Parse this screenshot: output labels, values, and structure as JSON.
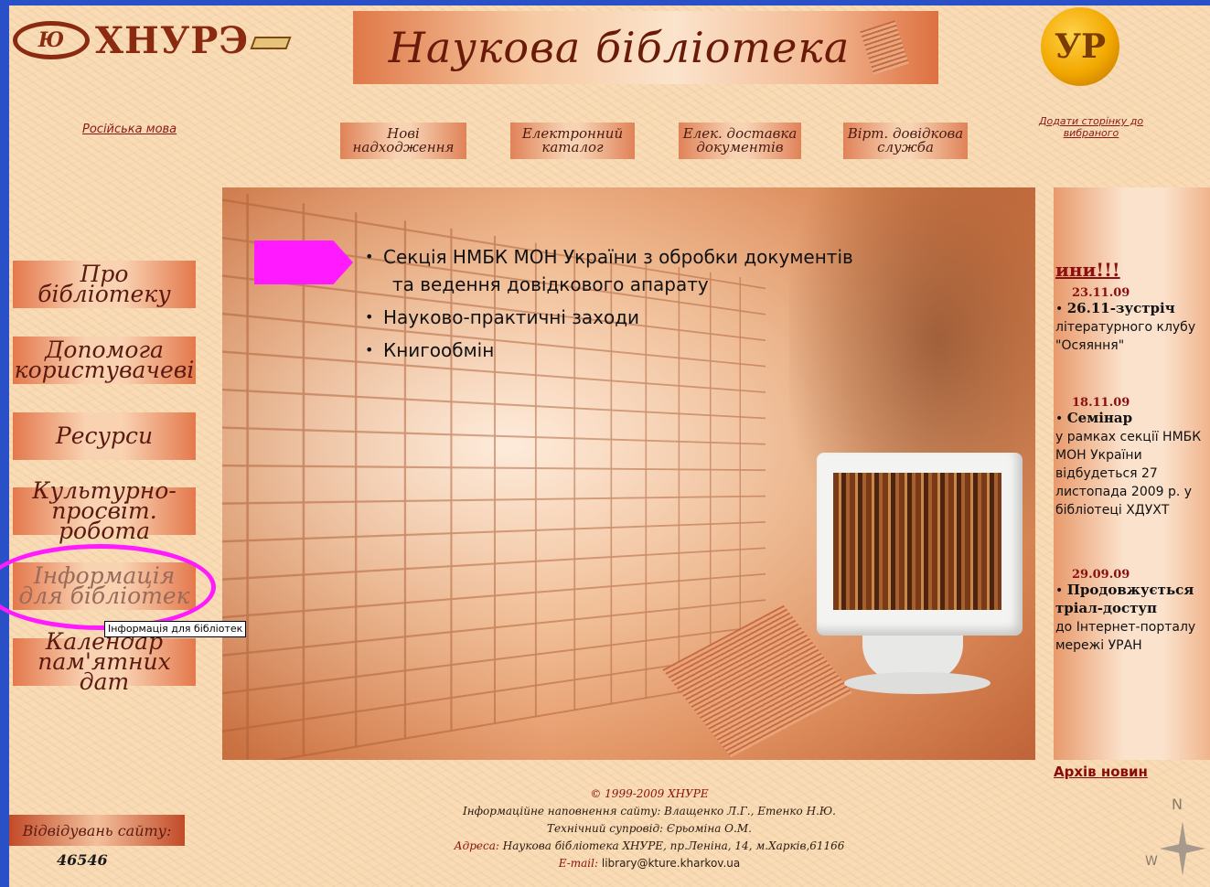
{
  "logo": {
    "emblem": "Ю",
    "text": "ХНУРЭ"
  },
  "banner": {
    "title": "Наукова бібліотека"
  },
  "coin": {
    "glyph": "УР"
  },
  "top_links": {
    "language": "Російська мова",
    "favorites": "Додати сторінку до вибраного"
  },
  "topnav": [
    "Нові надходження",
    "Електронний каталог",
    "Елек. доставка документів",
    "Вірт. довідкова служба"
  ],
  "leftmenu": [
    "Про бібліотеку",
    "Допомога користувачеві",
    "Ресурси",
    "Культурно-просвіт. робота",
    "Інформація для бібліотек",
    "Календар пам'ятних дат"
  ],
  "tooltip": "Інформація для бібліотек",
  "panel": {
    "items": [
      "Секція НМБК МОН України з обробки документів",
      "та ведення довідкового апарату",
      "Науково-практичні заходи",
      "Книгообмін"
    ]
  },
  "news": {
    "header": "ини!!!",
    "items": [
      {
        "date": "23.11.09",
        "title": "26.11-зустріч",
        "text": "літературного клубу \"Осяяння\""
      },
      {
        "date": "18.11.09",
        "title": "Семінар",
        "text": "у рамках секції НМБК МОН України відбудеться 27 листопада 2009 р. у бібліотеці ХДУХТ"
      },
      {
        "date": "29.09.09",
        "title": "Продовжується тріал-доступ",
        "text": "до Інтернет-порталу мережі УРАН"
      }
    ],
    "archive": "Архів новин"
  },
  "footer": {
    "copyright": "© 1999-2009 ХНУРЕ",
    "content_line": "Інформаційне наповнення сайту: Влащенко Л.Г., Етенко Н.Ю.",
    "tech_line": "Технічний супровід: Єрьоміна О.М.",
    "address_label": "Адреса:",
    "address_value": "Наукова бібліотека ХНУРЕ, пр.Леніна, 14, м.Харків,61166",
    "email_label": "E-mail:",
    "email_value": "library@kture.kharkov.ua"
  },
  "visits": {
    "label": "Відвідувань сайту:",
    "count": "46546"
  },
  "compass": {
    "n": "N",
    "w": "W"
  },
  "colors": {
    "accent_magenta": "#ff1aff",
    "link_red": "#8a1a1a",
    "page_bg": "#f9dcb6",
    "frame_blue": "#2a50c8"
  }
}
